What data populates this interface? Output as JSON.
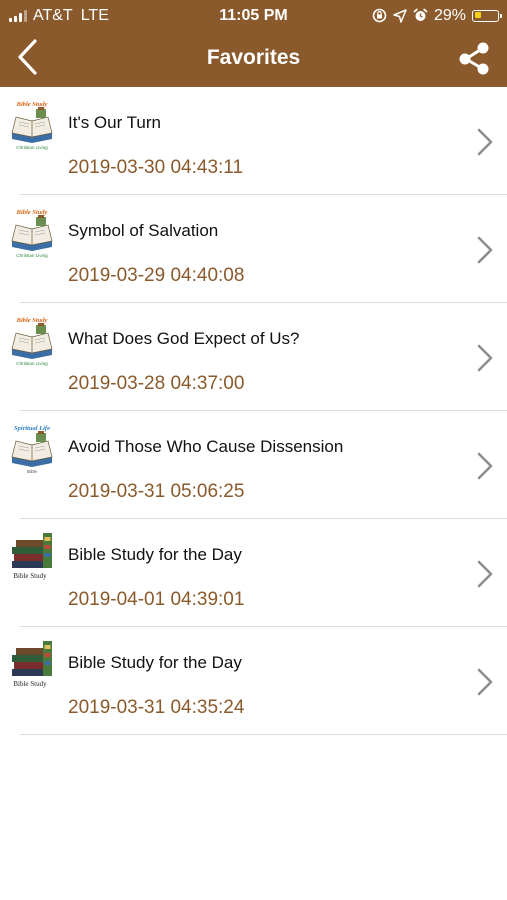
{
  "status_bar": {
    "carrier": "AT&T",
    "network": "LTE",
    "time": "11:05 PM",
    "battery_text": "29%",
    "battery_level": 0.29,
    "battery_color": "#f2d21b"
  },
  "nav": {
    "title": "Favorites",
    "back_icon": "chevron-left-icon",
    "share_icon": "share-icon",
    "bar_color": "#8a5a2c"
  },
  "favorites": [
    {
      "title": "It's Our Turn",
      "date": "2019-03-30 04:43:11",
      "thumb": "bible-study-christian-living-icon",
      "thumb_label_top": "Bible Study",
      "thumb_label_bottom": "Christian Living"
    },
    {
      "title": "Symbol of Salvation",
      "date": "2019-03-29 04:40:08",
      "thumb": "bible-study-christian-living-icon",
      "thumb_label_top": "Bible Study",
      "thumb_label_bottom": "Christian Living"
    },
    {
      "title": "What Does God Expect of Us?",
      "date": "2019-03-28 04:37:00",
      "thumb": "bible-study-christian-living-icon",
      "thumb_label_top": "Bible Study",
      "thumb_label_bottom": "Christian Living"
    },
    {
      "title": "Avoid Those Who Cause Dissension",
      "date": "2019-03-31 05:06:25",
      "thumb": "spiritual-life-bible-icon",
      "thumb_label_top": "Spiritual Life",
      "thumb_label_bottom": "Bible"
    },
    {
      "title": "Bible Study for the Day",
      "date": "2019-04-01 04:39:01",
      "thumb": "stacked-books-bible-study-icon",
      "thumb_label_top": "",
      "thumb_label_bottom": "Bible Study"
    },
    {
      "title": "Bible Study for the Day",
      "date": "2019-03-31 04:35:24",
      "thumb": "stacked-books-bible-study-icon",
      "thumb_label_top": "",
      "thumb_label_bottom": "Bible Study"
    }
  ]
}
